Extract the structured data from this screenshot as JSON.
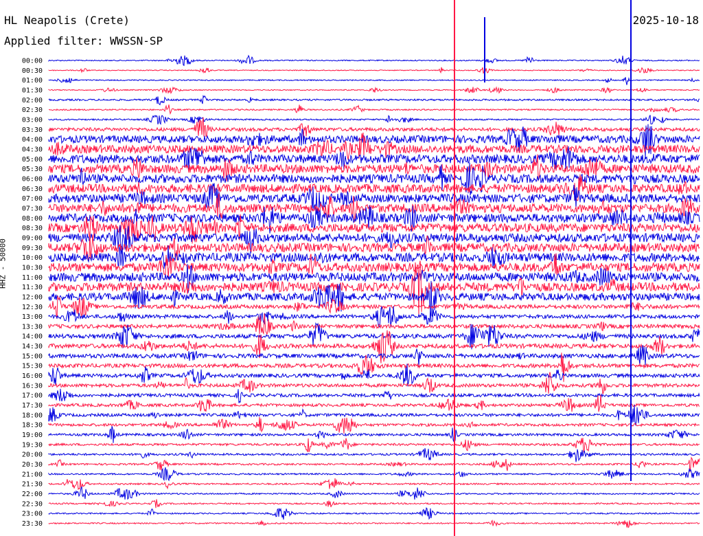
{
  "header": {
    "station": "HL Neapolis (Crete)",
    "date": "2025-10-18",
    "filter": "Applied filter: WWSSN-SP"
  },
  "chart_data": {
    "type": "line",
    "title": "HL Neapolis (Crete)",
    "ylabel": "HHZ - 50000",
    "ytick_labels": [
      "00:00",
      "00:30",
      "01:00",
      "01:30",
      "02:00",
      "02:30",
      "03:00",
      "03:30",
      "04:00",
      "04:30",
      "05:00",
      "05:30",
      "06:00",
      "06:30",
      "07:00",
      "07:30",
      "08:00",
      "08:30",
      "09:00",
      "09:30",
      "10:00",
      "10:30",
      "11:00",
      "11:30",
      "12:00",
      "12:30",
      "13:00",
      "13:30",
      "14:00",
      "14:30",
      "15:00",
      "15:30",
      "16:00",
      "16:30",
      "17:00",
      "17:30",
      "18:00",
      "18:30",
      "19:00",
      "19:30",
      "20:00",
      "20:30",
      "21:00",
      "21:30",
      "22:00",
      "22:30",
      "23:00",
      "23:30"
    ],
    "row_minutes": 30,
    "trace_colors": [
      "#0000e0",
      "#ff1744"
    ],
    "noise_level": [
      0.9,
      0.7,
      0.9,
      0.8,
      1.4,
      1.1,
      1.2,
      2.8,
      6,
      6.5,
      7,
      7,
      7,
      7,
      7,
      7,
      7,
      7,
      7,
      7,
      7,
      7,
      7,
      7,
      6,
      3.2,
      3,
      3.2,
      3.4,
      3.5,
      3.4,
      3.2,
      3,
      2.8,
      2.6,
      2.4,
      2.4,
      2.2,
      2,
      1.8,
      1.6,
      1.5,
      1.3,
      1.3,
      1.2,
      1.2,
      1.1,
      1.1
    ]
  }
}
